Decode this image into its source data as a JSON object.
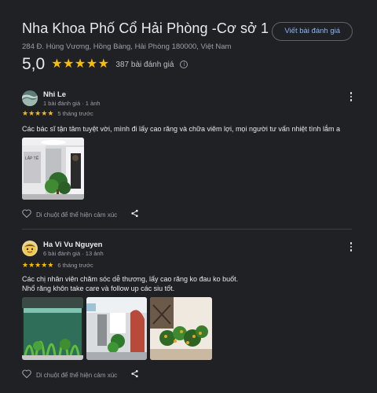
{
  "place": {
    "name": "Nha Khoa Phố Cổ Hải Phòng -Cơ sở 1",
    "address": "284 Đ. Hùng Vương, Hồng Bàng, Hải Phòng 180000, Việt Nam",
    "write_review_label": "Viết bài đánh giá",
    "rating": "5,0",
    "stars": 5,
    "review_count": "387 bài đánh giá"
  },
  "reviews": [
    {
      "author": "Nhi Le",
      "meta": "1 bài đánh giá · 1 ảnh",
      "time": "5 tháng trước",
      "text": "Các bác sĩ tận tâm tuyệt vời, mình đi lấy cao răng và chữa viêm lợi, mọi người tư vấn nhiệt tình lắm a",
      "react_label": "Di chuột để thể hiện cảm xúc",
      "photo_sign_text": "LẤP TẾ"
    },
    {
      "author": "Ha Vi Vu Nguyen",
      "meta": "6 bài đánh giá · 13 ảnh",
      "time": "6 tháng trước",
      "text_line1": "Các chị nhân viên chăm sóc dễ thương, lấy cao răng ko đau ko buốt.",
      "text_line2": "Nhổ răng khôn take care và follow up các siu tốt.",
      "react_label": "Di chuột để thể hiện cảm xúc"
    }
  ],
  "colors": {
    "background": "#202124",
    "star": "#fbbc04",
    "link": "#8ab4f8",
    "secondary_text": "#9aa0a6"
  }
}
